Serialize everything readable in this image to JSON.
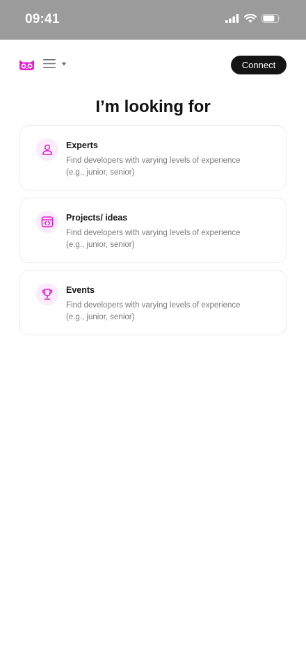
{
  "status_bar": {
    "time": "09:41",
    "icons": [
      "cellular-signal-icon",
      "wifi-icon",
      "battery-icon"
    ]
  },
  "header": {
    "logo": "owl-logo",
    "menu_icon": "hamburger-menu-icon",
    "menu_caret": "caret-down-icon",
    "connect_label": "Connect"
  },
  "colors": {
    "accent": "#e61ed6",
    "accent_soft": "#fcebf8",
    "button_bg": "#141414",
    "status_bar_bg": "#9b9b9b"
  },
  "main": {
    "title": "I’m looking for",
    "options": [
      {
        "icon": "user-icon",
        "title": "Experts",
        "desc_line1": "Find developers with varying levels of experience",
        "desc_line2": "(e.g., junior, senior)"
      },
      {
        "icon": "code-window-icon",
        "title": "Projects/ ideas",
        "desc_line1": "Find developers with varying levels of experience",
        "desc_line2": "(e.g., junior, senior)"
      },
      {
        "icon": "trophy-icon",
        "title": "Events",
        "desc_line1": "Find developers with varying levels of experience",
        "desc_line2": "(e.g., junior, senior)"
      }
    ]
  }
}
